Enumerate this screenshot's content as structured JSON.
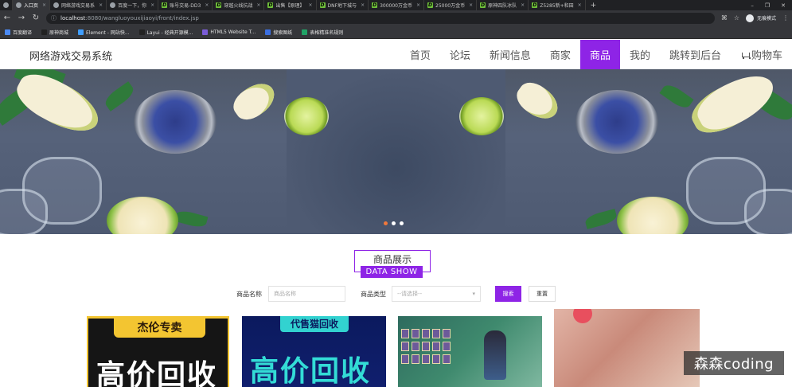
{
  "browser": {
    "tabs": [
      {
        "label": "",
        "active": false
      },
      {
        "label": "入口页",
        "active": true
      },
      {
        "label": "网络游戏交易系",
        "active": false
      },
      {
        "label": "百度一下，你",
        "active": false
      },
      {
        "label": "账号交易-DD3",
        "active": false
      },
      {
        "label": "穿越火线抗战",
        "active": false
      },
      {
        "label": "出售【原理】",
        "active": false
      },
      {
        "label": "DNF地下城与",
        "active": false
      },
      {
        "label": "300000万金币",
        "active": false
      },
      {
        "label": "25000万金币",
        "active": false
      },
      {
        "label": "原神四队冰队",
        "active": false
      },
      {
        "label": "Z5285新+和田",
        "active": false
      }
    ],
    "address": {
      "host": "localhost",
      "path": ":8080/wangluoyouxijiaoyi/front/index.jsp"
    },
    "profile_label": "无痕模式",
    "bookmarks": [
      "百度翻译",
      "原神商城",
      "Element - 网站快...",
      "Layui - 经典开源模...",
      "HTML5 Website T...",
      "搜索图纸",
      "表格精准名规则"
    ]
  },
  "site": {
    "brand": "网络游戏交易系统",
    "menu": [
      "首页",
      "论坛",
      "新闻信息",
      "商家",
      "商品",
      "我的",
      "跳转到后台",
      "购物车"
    ],
    "active_menu": "商品"
  },
  "carousel": {
    "slide_count": 3,
    "active_index": 0
  },
  "section": {
    "title": "商品展示",
    "subtitle": "DATA SHOW"
  },
  "search": {
    "name_label": "商品名称",
    "name_placeholder": "商品名称",
    "type_label": "商品类型",
    "type_placeholder": "--请选择--",
    "search_button": "搜索",
    "reset_button": "重置"
  },
  "products": [
    {
      "tag": "杰伦专卖",
      "headline": "高价回收",
      "accent": "#f3c531"
    },
    {
      "tag": "代售猫回收",
      "headline": "高价回收",
      "accent": "#32d2d0"
    },
    {
      "tag": "",
      "headline": "",
      "accent": "#3f8a6e"
    },
    {
      "tag": "",
      "headline": "",
      "accent": "#c98a7a"
    }
  ],
  "watermark": "森森coding",
  "colors": {
    "primary": "#8e24e6",
    "carousel_active_dot": "#f0783c"
  }
}
